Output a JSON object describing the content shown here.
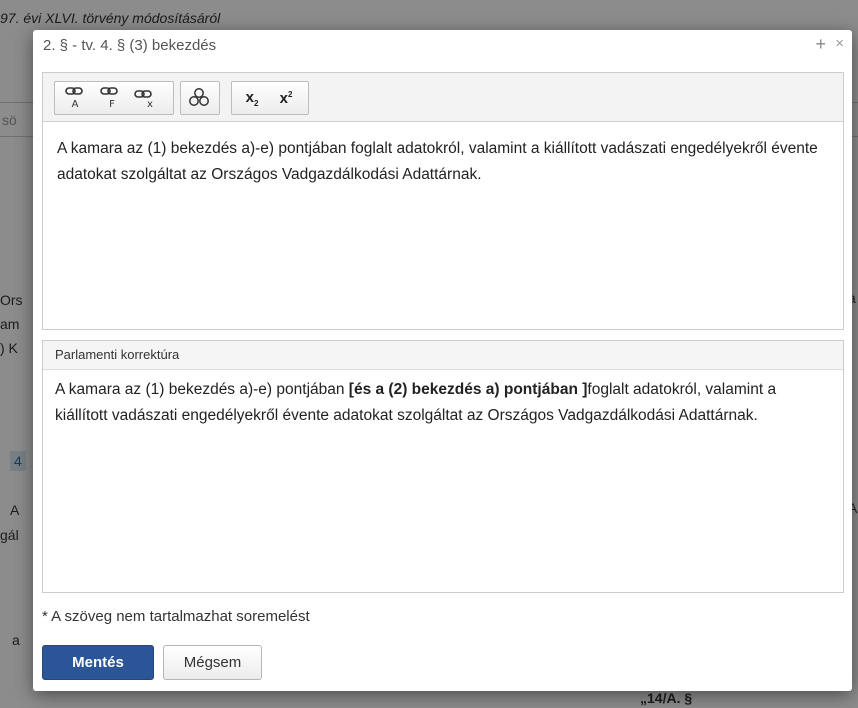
{
  "background": {
    "heading_fragment": "97. évi XLVI. törvény módosításáról",
    "search_fragment": "sö",
    "left_fragments": [
      "Ors",
      "am",
      ") K"
    ],
    "badge_fragment": "4",
    "left_fragments2": [
      "A",
      "gál"
    ],
    "bottom_fragment": "a",
    "right_fragments": [
      "a",
      "A:"
    ],
    "section_fragment": "„14/A. §"
  },
  "dialog": {
    "title": "2. § - tv. 4. § (3) bekezdés",
    "plus_label": "+",
    "close_label": "×"
  },
  "toolbar": {
    "icons": [
      "link-a-icon",
      "link-f-icon",
      "unlink-icon",
      "insert-special-icon",
      "subscript-icon",
      "superscript-icon"
    ],
    "subscript_label": "x",
    "subscript_mark": "2",
    "superscript_label": "x",
    "superscript_mark": "2"
  },
  "editor": {
    "text": "A kamara az (1) bekezdés a)-e) pontjában foglalt adatokról, valamint a kiállított vadászati engedélyekről évente adatokat szolgáltat az Országos Vadgazdálkodási Adattárnak."
  },
  "correction": {
    "header": "Parlamenti korrektúra",
    "text_before": "A kamara az (1) bekezdés a)-e) pontjában ",
    "text_bold": "[és a (2) bekezdés a) pontjában ]",
    "text_after": "foglalt adatokról, valamint a kiállított vadászati engedélyekről évente adatokat szolgáltat az Országos Vadgazdálkodási Adattárnak."
  },
  "footer": {
    "note": "* A szöveg nem tartalmazhat soremelést",
    "save_label": "Mentés",
    "cancel_label": "Mégsem"
  },
  "colors": {
    "save_button": "#2c5597",
    "overlay": "rgba(0,0,0,0.45)"
  }
}
